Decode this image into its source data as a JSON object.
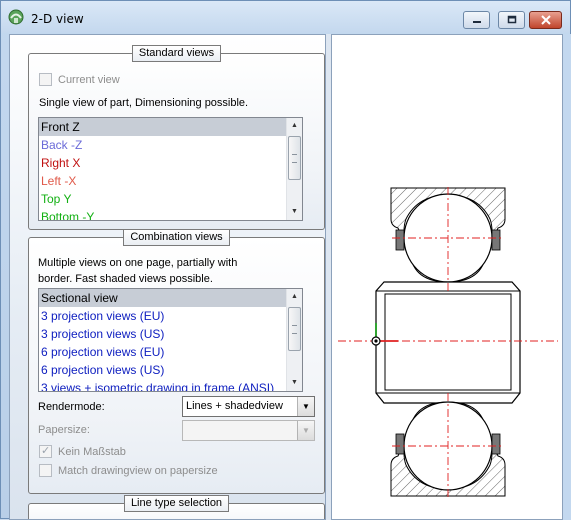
{
  "window": {
    "title": "2-D view",
    "icon": "app-icon"
  },
  "titlebar_buttons": {
    "minimize": "minimize-icon",
    "maximize": "maximize-icon",
    "close": "close-icon"
  },
  "standard_views": {
    "title": "Standard views",
    "current_view_label": "Current view",
    "current_view_checked": false,
    "description": "Single view of part, Dimensioning possible.",
    "items": [
      {
        "label": "Front Z",
        "color": "#000000",
        "selected": true
      },
      {
        "label": "Back -Z",
        "color": "#6a6ad8"
      },
      {
        "label": "Right X",
        "color": "#c01010"
      },
      {
        "label": "Left -X",
        "color": "#e05a4a"
      },
      {
        "label": "Top Y",
        "color": "#12b012"
      },
      {
        "label": "Bottom -Y",
        "color": "#12b012"
      }
    ]
  },
  "combination_views": {
    "title": "Combination views",
    "description_line1": "Multiple views on one page, partially with",
    "description_line2": "border. Fast shaded views possible.",
    "items": [
      {
        "label": "Sectional view",
        "color": "#000000",
        "selected": true
      },
      {
        "label": "3 projection views (EU)",
        "color": "#1020c0"
      },
      {
        "label": "3 projection views (US)",
        "color": "#1020c0"
      },
      {
        "label": "6 projection views (EU)",
        "color": "#1020c0"
      },
      {
        "label": "6 projection views (US)",
        "color": "#1020c0"
      },
      {
        "label": "3 views + isometric drawing in frame (ANSI)",
        "color": "#1020c0"
      }
    ],
    "rendermode_label": "Rendermode:",
    "rendermode_value": "Lines + shadedview",
    "papersize_label": "Papersize:",
    "papersize_value": "",
    "kein_massstab_label": "Kein Maßstab",
    "kein_massstab_checked": true,
    "match_label": "Match drawingview on papersize",
    "match_checked": false
  },
  "line_type_selection": {
    "title": "Line type selection"
  },
  "drawing": {
    "description": "sectional view of bearing",
    "line_color": "#000000",
    "hatch_color": "#404040",
    "centerline_color": "#e02020",
    "axis_x_color": "#e02020",
    "axis_y_color": "#20a020"
  }
}
